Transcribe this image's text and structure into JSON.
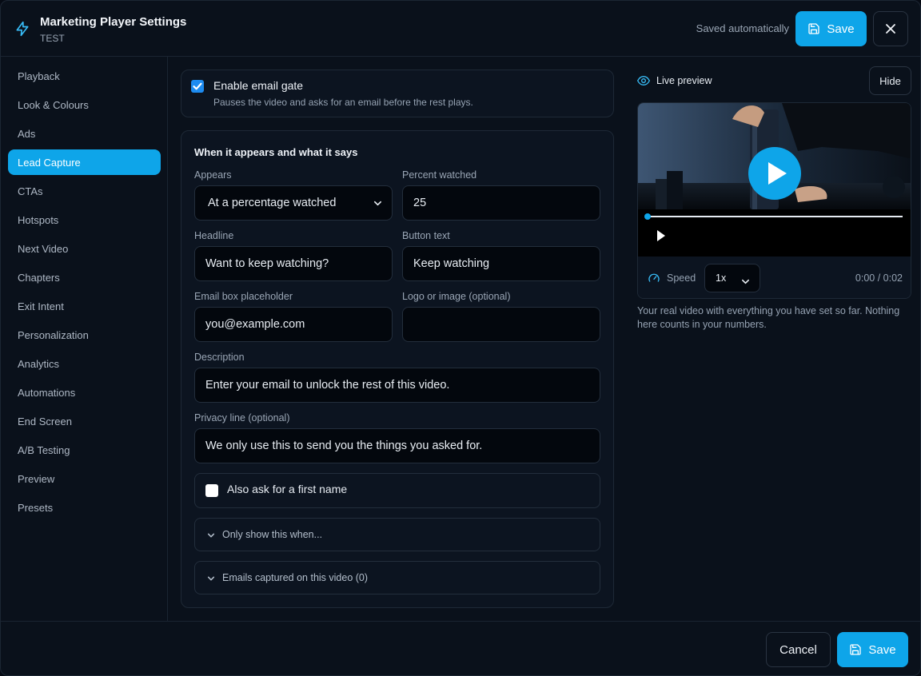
{
  "header": {
    "title": "Marketing Player Settings",
    "subtitle": "TEST",
    "status": "Saved automatically",
    "save_label": "Save",
    "accent": "#0ea5e9"
  },
  "sidebar": {
    "items": [
      {
        "label": "Playback"
      },
      {
        "label": "Look & Colours"
      },
      {
        "label": "Ads"
      },
      {
        "label": "Lead Capture",
        "active": true
      },
      {
        "label": "CTAs"
      },
      {
        "label": "Hotspots"
      },
      {
        "label": "Next Video"
      },
      {
        "label": "Chapters"
      },
      {
        "label": "Exit Intent"
      },
      {
        "label": "Personalization"
      },
      {
        "label": "Analytics"
      },
      {
        "label": "Automations"
      },
      {
        "label": "End Screen"
      },
      {
        "label": "A/B Testing"
      },
      {
        "label": "Preview"
      },
      {
        "label": "Presets"
      }
    ]
  },
  "gate": {
    "checked": true,
    "label": "Enable email gate",
    "help": "Pauses the video and asks for an email before the rest plays."
  },
  "form": {
    "section_title": "When it appears and what it says",
    "appears_label": "Appears",
    "appears_value": "At a percentage watched",
    "percent_label": "Percent watched",
    "percent_value": "25",
    "headline_label": "Headline",
    "headline_value": "Want to keep watching?",
    "button_text_label": "Button text",
    "button_text_value": "Keep watching",
    "placeholder_label": "Email box placeholder",
    "placeholder_value": "you@example.com",
    "logo_label": "Logo or image (optional)",
    "logo_value": "",
    "description_label": "Description",
    "description_value": "Enter your email to unlock the rest of this video.",
    "privacy_label": "Privacy line (optional)",
    "privacy_value": "We only use this to send you the things you asked for.",
    "first_name_label": "Also ask for a first name",
    "first_name_checked": false,
    "only_show_label": "Only show this when...",
    "emails_captured_label": "Emails captured on this video (0)"
  },
  "preview": {
    "title": "Live preview",
    "hide_label": "Hide",
    "speed_label": "Speed",
    "speed_value": "1x",
    "time": "0:00 / 0:02",
    "progress": 0,
    "note": "Your real video with everything you have set so far. Nothing here counts in your numbers."
  },
  "footer": {
    "cancel_label": "Cancel",
    "save_label": "Save"
  }
}
